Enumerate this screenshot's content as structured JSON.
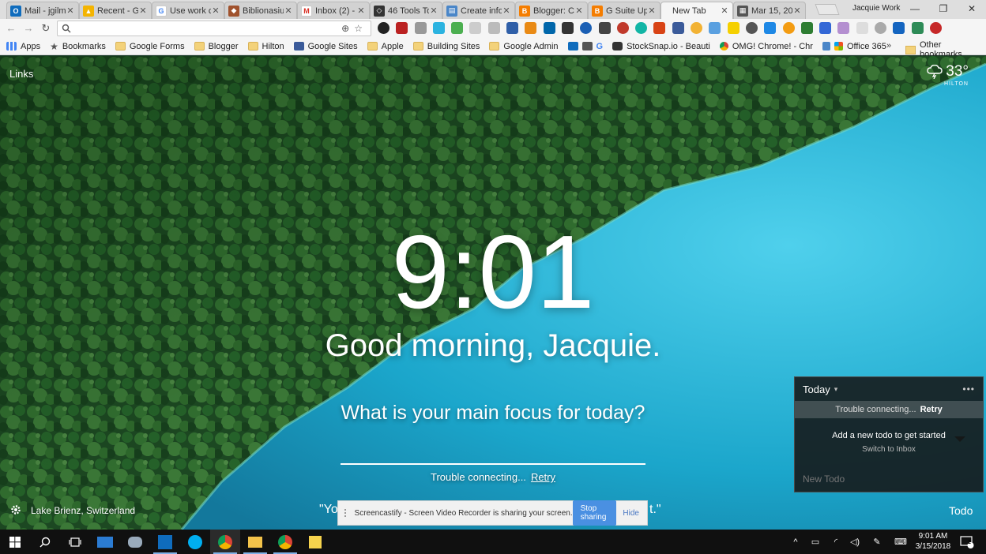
{
  "tabs": [
    {
      "title": "Mail - jgilm",
      "favicon": "outlook-icon",
      "color": "#0f6cbd"
    },
    {
      "title": "Recent - G",
      "favicon": "drive-icon",
      "color": "#f4b400"
    },
    {
      "title": "Use work c",
      "favicon": "google-icon",
      "color": "#4285f4"
    },
    {
      "title": "Biblionasiu",
      "favicon": "site-icon",
      "color": "#a0522d"
    },
    {
      "title": "Inbox (2) -",
      "favicon": "gmail-icon",
      "color": "#d93025"
    },
    {
      "title": "46 Tools To",
      "favicon": "tools-icon",
      "color": "#333333"
    },
    {
      "title": "Create info",
      "favicon": "chart-icon",
      "color": "#4a86c8"
    },
    {
      "title": "Blogger: C",
      "favicon": "blogger-icon",
      "color": "#f57d00"
    },
    {
      "title": "G Suite Up",
      "favicon": "blogger-icon",
      "color": "#f57d00"
    },
    {
      "title": "New Tab",
      "favicon": "",
      "color": ""
    },
    {
      "title": "Mar 15, 20",
      "favicon": "film-icon",
      "color": "#555555"
    }
  ],
  "profile_name": "Jacquie Work",
  "bookmarks": [
    {
      "label": "Apps",
      "icon": "apps-grid-icon"
    },
    {
      "label": "Bookmarks",
      "icon": "star-icon"
    },
    {
      "label": "Google Forms",
      "icon": "folder-icon"
    },
    {
      "label": "Blogger",
      "icon": "folder-icon"
    },
    {
      "label": "Hilton",
      "icon": "folder-icon"
    },
    {
      "label": "Google Sites",
      "icon": "sites-icon"
    },
    {
      "label": "Apple",
      "icon": "folder-icon"
    },
    {
      "label": "Building Sites",
      "icon": "folder-icon"
    },
    {
      "label": "Google Admin",
      "icon": "folder-icon"
    },
    {
      "label": "StockSnap.io - Beauti",
      "icon": "camera-icon"
    },
    {
      "label": "OMG! Chrome! - Chr",
      "icon": "chrome-icon"
    },
    {
      "label": "Office 365",
      "icon": "office-icon"
    }
  ],
  "bookmarks_more": "»",
  "other_bookmarks": "Other bookmarks",
  "newtab": {
    "links_label": "Links",
    "weather_temp": "33°",
    "weather_location": "HILTON",
    "time": "9:01",
    "greeting": "Good morning, Jacquie.",
    "focus_question": "What is your main focus for today?",
    "trouble_text": "Trouble connecting...",
    "retry_label": "Retry",
    "quote_left": "\"You",
    "quote_right": "t.\"",
    "photo_location": "Lake Brienz, Switzerland",
    "todo_label": "Todo"
  },
  "share_bar": {
    "message": "Screencastify - Screen Video Recorder is sharing your screen.",
    "stop_label": "Stop sharing",
    "hide_label": "Hide"
  },
  "todo_panel": {
    "title": "Today",
    "error_text": "Trouble connecting...",
    "retry_label": "Retry",
    "empty_text": "Add a new todo to get started",
    "switch_text": "Switch to Inbox",
    "new_placeholder": "New Todo"
  },
  "taskbar": {
    "time": "9:01 AM",
    "date": "3/15/2018",
    "notification_count": "2"
  },
  "colors": {
    "forest": "#2f6b35",
    "lake": "#1aa5c9",
    "accent_blue": "#4a90e2"
  }
}
